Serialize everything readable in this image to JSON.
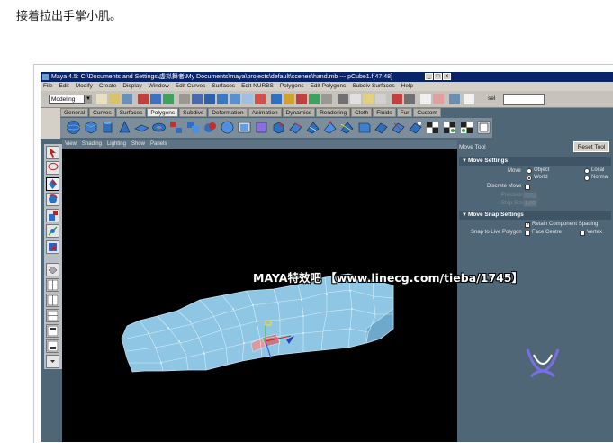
{
  "caption": "接着拉出手掌小肌。",
  "window": {
    "title": "Maya 4.5: C:\\Documents and Settings\\虚拟舞者\\My Documents\\maya\\projects\\default\\scenes\\hand.mb   ---   pCube1.f[47:48]",
    "buttons": [
      "_",
      "□",
      "×"
    ]
  },
  "menubar": [
    "File",
    "Edit",
    "Modify",
    "Create",
    "Display",
    "Window",
    "Edit Curves",
    "Surfaces",
    "Edit NURBS",
    "Polygons",
    "Edit Polygons",
    "Subdiv Surfaces",
    "Help"
  ],
  "status": {
    "mode": "Modeling",
    "sel_label": "sel"
  },
  "shelf_tabs": [
    "General",
    "Curves",
    "Surfaces",
    "Polygons",
    "Subdivs",
    "Deformation",
    "Animation",
    "Dynamics",
    "Rendering",
    "Cloth",
    "Fluids",
    "Fur",
    "Custom"
  ],
  "shelf_active": "Polygons",
  "panel_menu": [
    "View",
    "Shading",
    "Lighting",
    "Show",
    "Panels"
  ],
  "tool_settings": {
    "title": "Move Tool",
    "reset_label": "Reset Tool",
    "section1": "Move Settings",
    "move_label": "Move",
    "options": [
      "Object",
      "Local",
      "World",
      "Normal"
    ],
    "selected_option": "World",
    "discrete_move": "Discrete Move",
    "precision": "Precision",
    "step_size": "Step Size",
    "step_value": "1.00",
    "section2": "Move Snap Settings",
    "retain_spacing": "Retain Component Spacing",
    "snap_live": "Snap to Live Polygon",
    "face_centre": "Face Centre",
    "vertex": "Vertex"
  },
  "watermark": "MAYA特效吧 【www.linecg.com/tieba/1745】",
  "colors": {
    "maya_bg": "#4f6677",
    "viewport": "#000000",
    "mesh": "#8fc6e3",
    "titlebar": "#0a246a"
  }
}
